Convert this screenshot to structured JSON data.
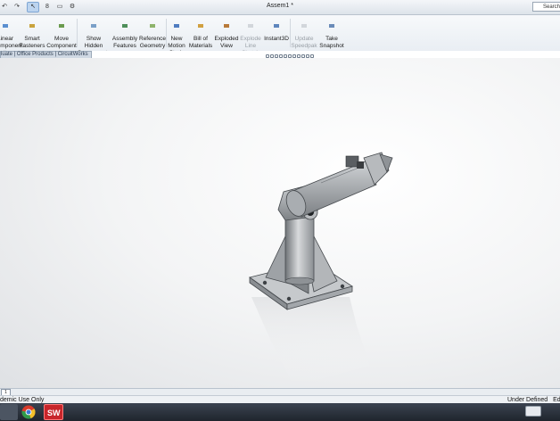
{
  "window": {
    "title": "Assem1 *",
    "search_placeholder": "Search"
  },
  "ribbon": {
    "tools": [
      {
        "label": "Linear\nComponent\nPattern",
        "icon": "pattern-icon",
        "enabled": true
      },
      {
        "label": "Smart\nFasteners",
        "icon": "fastener-icon",
        "enabled": true
      },
      {
        "label": "Move\nComponent",
        "icon": "move-icon",
        "enabled": true
      },
      {
        "label": "Show\nHidden\nComponents",
        "icon": "show-hidden-icon",
        "enabled": true
      },
      {
        "label": "Assembly\nFeatures",
        "icon": "assembly-features-icon",
        "enabled": true
      },
      {
        "label": "Reference\nGeometry",
        "icon": "reference-geometry-icon",
        "enabled": true
      },
      {
        "label": "New\nMotion\nStudy",
        "icon": "motion-study-icon",
        "enabled": true
      },
      {
        "label": "Bill of\nMaterials",
        "icon": "bom-icon",
        "enabled": true
      },
      {
        "label": "Exploded\nView",
        "icon": "exploded-view-icon",
        "enabled": true
      },
      {
        "label": "Explode\nLine\nSketch",
        "icon": "explode-line-icon",
        "enabled": false
      },
      {
        "label": "Instant3D",
        "icon": "instant3d-icon",
        "enabled": true
      },
      {
        "label": "Update\nSpeedpak",
        "icon": "speedpak-icon",
        "enabled": false
      },
      {
        "label": "Take\nSnapshot",
        "icon": "snapshot-icon",
        "enabled": true
      }
    ]
  },
  "tab_strip": "luate | Office Products | CircuitWorks",
  "sheet_tab": "1",
  "status": {
    "left": "demic Use Only",
    "right": "Under Defined",
    "right_extra": "Ed"
  },
  "taskbar": {
    "items": [
      "windows-explorer-icon",
      "chrome-icon",
      "solidworks-icon"
    ],
    "keyboard_icon": "keyboard-icon"
  }
}
